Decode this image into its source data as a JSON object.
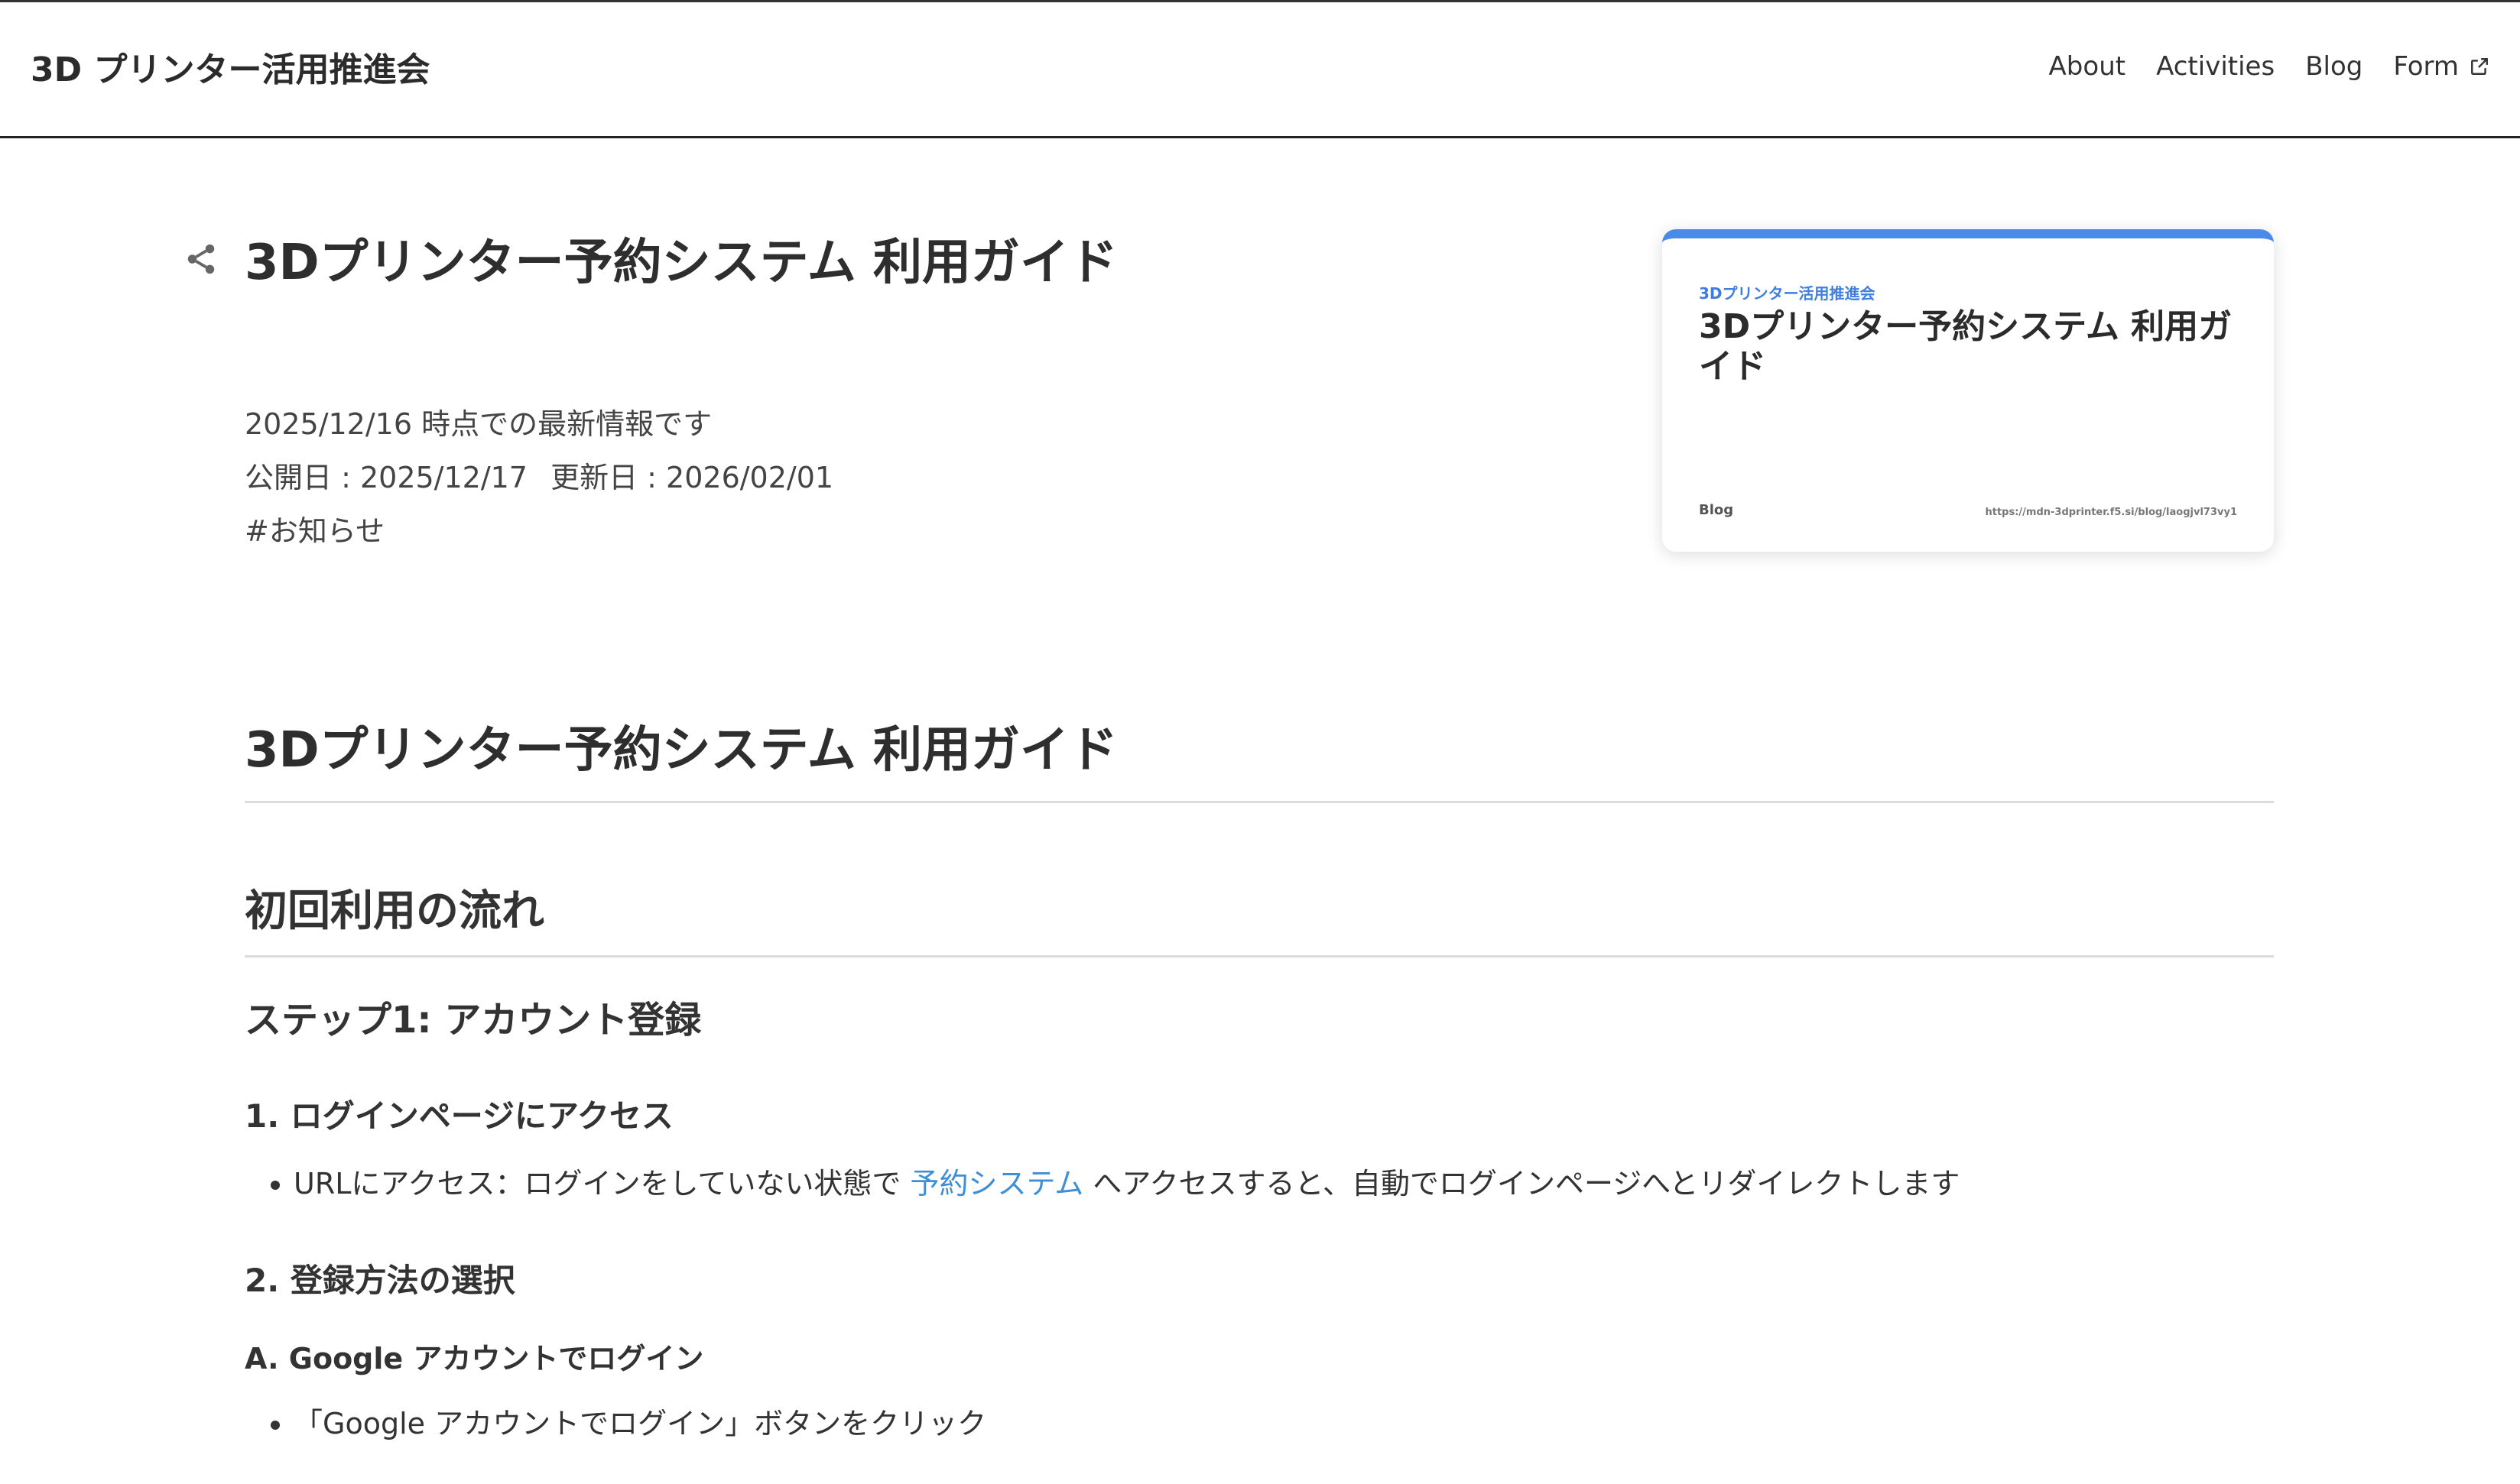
{
  "header": {
    "site_title": "3D プリンター活用推進会",
    "nav": [
      {
        "label": "About"
      },
      {
        "label": "Activities"
      },
      {
        "label": "Blog"
      },
      {
        "label": "Form"
      }
    ]
  },
  "article": {
    "title": "3Dプリンター予約システム 利用ガイド",
    "notice": "2025/12/16 時点での最新情報です",
    "published": "公開日 : 2025/12/17",
    "updated": "更新日 : 2026/02/01",
    "tag": "#お知らせ"
  },
  "og_card": {
    "site": "3Dプリンター活用推進会",
    "title": "3Dプリンター予約システム 利用ガイド",
    "label": "Blog",
    "url": "https://mdn-3dprinter.f5.si/blog/laogjvl73vy1",
    "accent_color": "#4a8bea"
  },
  "content": {
    "h1": "3Dプリンター予約システム 利用ガイド",
    "h2": "初回利用の流れ",
    "h3": "ステップ1: アカウント登録",
    "step1_heading": "1. ログインページにアクセス",
    "step1_bullet_before": "URLにアクセス：ログインをしていない状態で ",
    "step1_bullet_link": "予約システム",
    "step1_bullet_after": " へアクセスすると、自動でログインページへとリダイレクトします",
    "step2_heading": "2. 登録方法の選択",
    "option_a_heading": "A. Google アカウントでログイン",
    "option_a_bullet_1": "「Google アカウントでログイン」ボタンをクリック"
  },
  "colors": {
    "link": "#3f8fd6",
    "text": "#333333"
  },
  "icons": {
    "share": "share-icon",
    "external": "external-link-icon"
  }
}
